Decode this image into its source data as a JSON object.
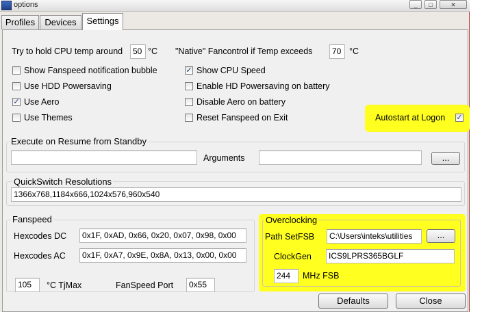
{
  "window": {
    "title": "options"
  },
  "title_buttons": {
    "minimize": "_",
    "maximize": "□",
    "close": "✕"
  },
  "tabs": [
    {
      "label": "Profiles",
      "active": false
    },
    {
      "label": "Devices",
      "active": false
    },
    {
      "label": "Settings",
      "active": true
    }
  ],
  "settings": {
    "cpu_temp_label": "Try to hold CPU temp around",
    "cpu_temp_value": "50",
    "cpu_temp_unit": "°C",
    "native_label": "\"Native\" Fancontrol if Temp exceeds",
    "native_value": "70",
    "native_unit": "°C",
    "checkboxes": [
      {
        "label": "Show Fanspeed notification bubble",
        "checked": false
      },
      {
        "label": "Use HDD Powersaving",
        "checked": false
      },
      {
        "label": "Use Aero",
        "checked": true
      },
      {
        "label": "Use Themes",
        "checked": false
      },
      {
        "label": "Show CPU Speed",
        "checked": true
      },
      {
        "label": "Enable HD Powersaving on battery",
        "checked": false
      },
      {
        "label": "Disable Aero on battery",
        "checked": false
      },
      {
        "label": "Reset Fanspeed on Exit",
        "checked": false
      }
    ],
    "autostart": {
      "label": "Autostart at Logon",
      "checked": true
    },
    "check_mark": "✓"
  },
  "resume": {
    "title": "Execute on Resume from Standby",
    "command_value": "",
    "arguments_label": "Arguments",
    "arguments_value": "",
    "browse_label": "..."
  },
  "quickswitch": {
    "title": "QuickSwitch Resolutions",
    "value": "1366x768,1184x666,1024x576,960x540"
  },
  "fanspeed": {
    "title": "Fanspeed",
    "dc_label": "Hexcodes DC",
    "dc_value": "0x1F, 0xAD, 0x66, 0x20, 0x07, 0x98, 0x00",
    "ac_label": "Hexcodes AC",
    "ac_value": "0x1F, 0xA7, 0x9E, 0x8A, 0x13, 0x00, 0x00",
    "tjmax_value": "105",
    "tjmax_label": "°C TjMax",
    "port_label": "FanSpeed Port",
    "port_value": "0x55"
  },
  "overclocking": {
    "title": "Overclocking",
    "path_label": "Path SetFSB",
    "path_value": "C:\\Users\\inteks\\utilities",
    "browse_label": "...",
    "clockgen_label": "ClockGen",
    "clockgen_value": "ICS9LPRS365BGLF",
    "fsb_value": "244",
    "fsb_label": "MHz FSB"
  },
  "footer": {
    "defaults_label": "Defaults",
    "close_label": "Close"
  },
  "colors": {
    "highlight": "#ffff20",
    "window_border": "#b53b3b"
  }
}
